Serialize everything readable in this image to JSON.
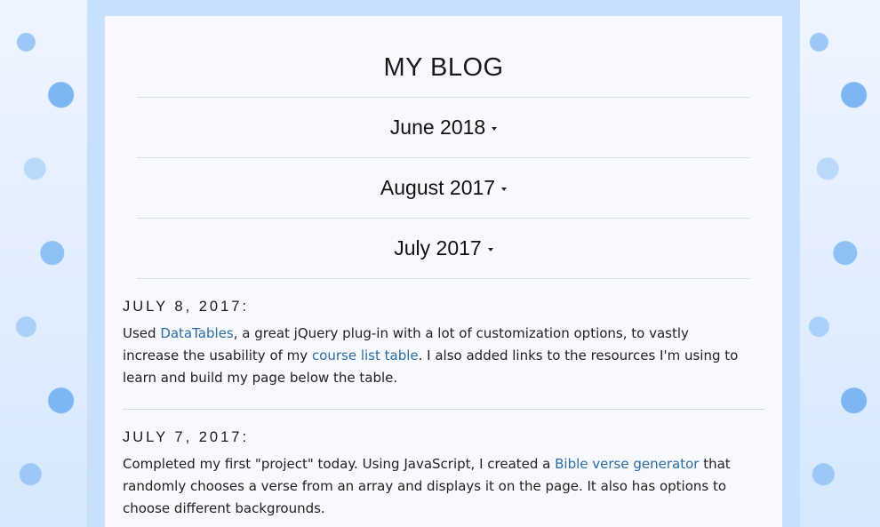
{
  "blog": {
    "title": "MY BLOG"
  },
  "months": [
    "June 2018",
    "August 2017",
    "July 2017"
  ],
  "entries": [
    {
      "date": "JULY 8, 2017:",
      "t1": "Used ",
      "link1": "DataTables",
      "t2": ", a great jQuery plug-in with a lot of customization options, to vastly increase the usability of my ",
      "link2": "course list table",
      "t3": ". I also added links to the resources I'm using to learn and build my page below the table."
    },
    {
      "date": "JULY 7, 2017:",
      "t1": "Completed my first \"project\" today. Using JavaScript, I created a ",
      "link1": "Bible verse generator",
      "t2": " that randomly chooses a verse from an array and displays it on the page. It also has options to choose different backgrounds."
    }
  ]
}
